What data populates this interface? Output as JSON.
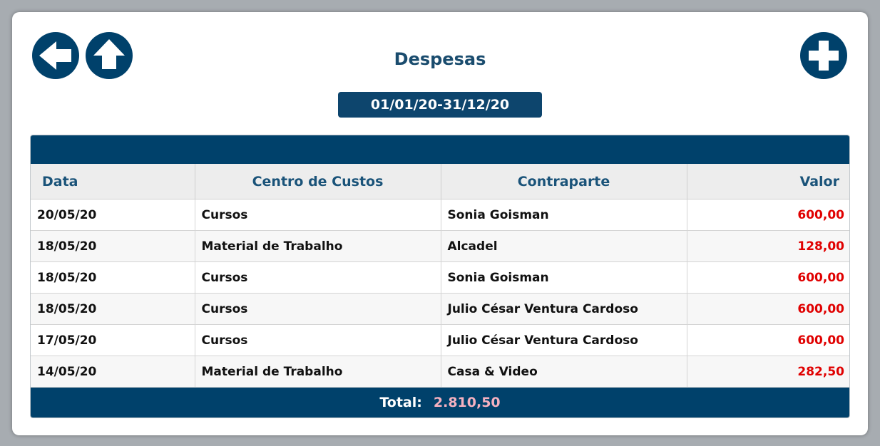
{
  "header": {
    "title": "Despesas",
    "period_start": "01/01/20",
    "period_end": "31/12/20",
    "period_separator": "-"
  },
  "icons": {
    "back": "arrow-left-icon",
    "home": "arrow-up-icon",
    "add": "plus-icon"
  },
  "table": {
    "columns": [
      "Data",
      "Centro de Custos",
      "Contraparte",
      "Valor"
    ],
    "rows": [
      {
        "data": "20/05/20",
        "centro": "Cursos",
        "contraparte": "Sonia Goisman",
        "valor": "600,00"
      },
      {
        "data": "18/05/20",
        "centro": "Material de Trabalho",
        "contraparte": "Alcadel",
        "valor": "128,00"
      },
      {
        "data": "18/05/20",
        "centro": "Cursos",
        "contraparte": "Sonia Goisman",
        "valor": "600,00"
      },
      {
        "data": "18/05/20",
        "centro": "Cursos",
        "contraparte": "Julio César Ventura Cardoso",
        "valor": "600,00"
      },
      {
        "data": "17/05/20",
        "centro": "Cursos",
        "contraparte": "Julio César Ventura Cardoso",
        "valor": "600,00"
      },
      {
        "data": "14/05/20",
        "centro": "Material de Trabalho",
        "contraparte": "Casa & Video",
        "valor": "282,50"
      }
    ]
  },
  "footer": {
    "total_label": "Total:",
    "total_value": "2.810,50"
  },
  "colors": {
    "primary": "#00416b",
    "title": "#1a4c6e",
    "negative_value": "#e00000",
    "total_value": "#f5b1c0"
  }
}
